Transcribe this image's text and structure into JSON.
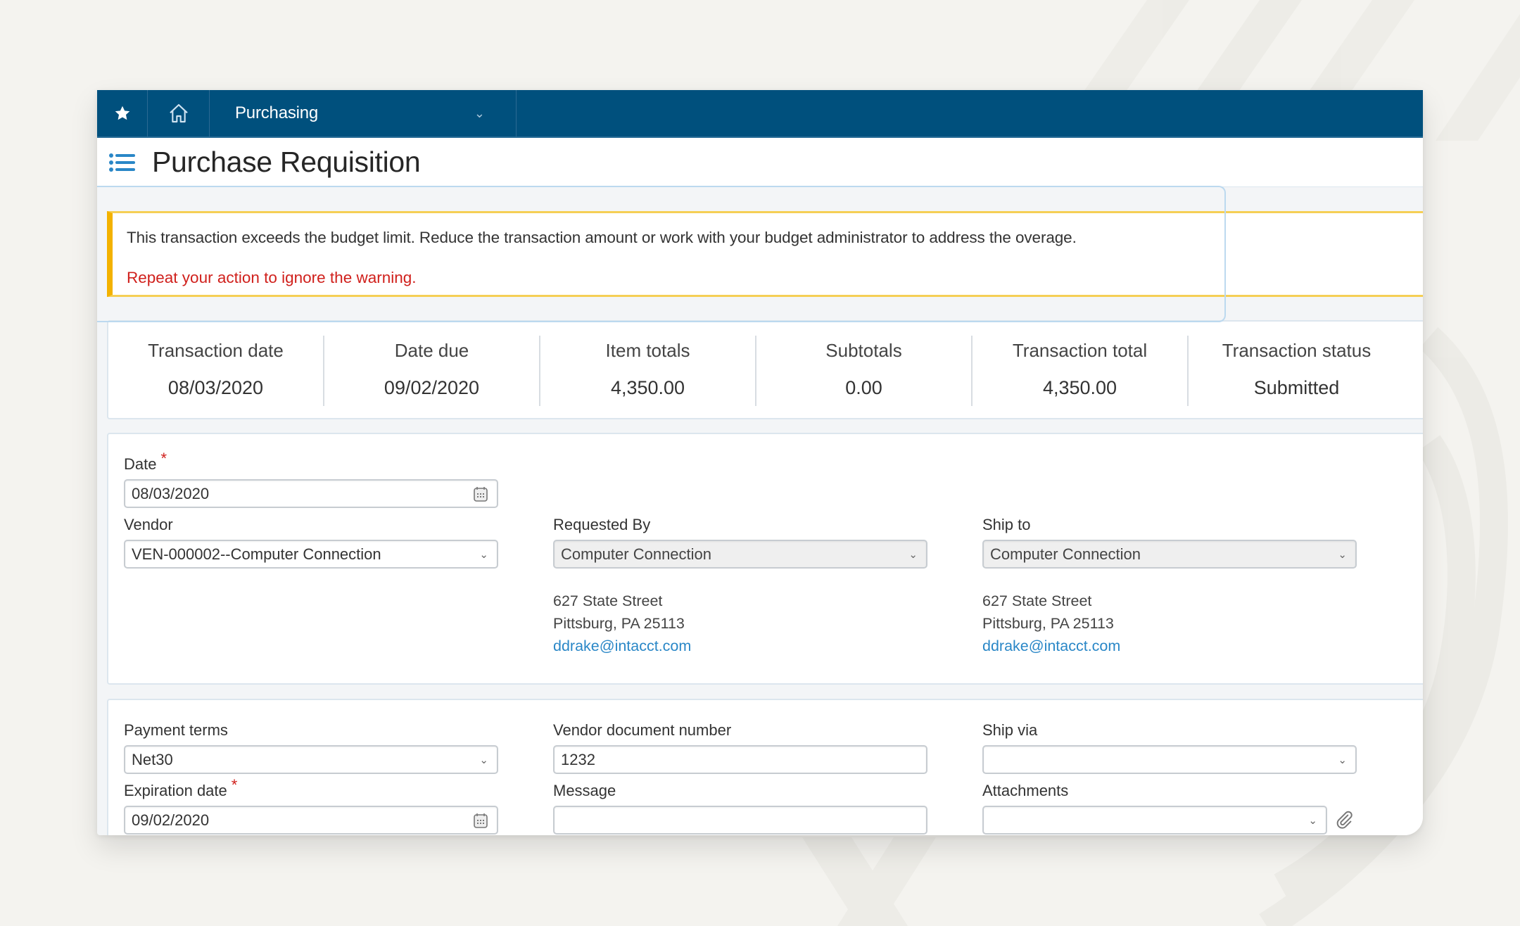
{
  "nav": {
    "favorites_icon": "star-icon",
    "home_icon": "home-icon",
    "module_label": "Purchasing",
    "module_chevron": "chevron-down-icon"
  },
  "page": {
    "menu_icon": "list-menu-icon",
    "title": "Purchase Requisition"
  },
  "warning": {
    "message": "This transaction exceeds the budget limit. Reduce the transaction amount or work with your budget administrator to address the overage.",
    "hint": "Repeat your action to ignore the warning.",
    "accent_color": "#f3b200",
    "hint_color": "#d0201c"
  },
  "summary": [
    {
      "label": "Transaction date",
      "value": "08/03/2020"
    },
    {
      "label": "Date due",
      "value": "09/02/2020"
    },
    {
      "label": "Item totals",
      "value": "4,350.00"
    },
    {
      "label": "Subtotals",
      "value": "0.00"
    },
    {
      "label": "Transaction total",
      "value": "4,350.00"
    },
    {
      "label": "Transaction status",
      "value": "Submitted"
    }
  ],
  "header_fields": {
    "date": {
      "label": "Date",
      "required": "*",
      "value": "08/03/2020",
      "icon": "calendar-icon"
    },
    "vendor": {
      "label": "Vendor",
      "value": "VEN-000002--Computer Connection"
    },
    "requested_by": {
      "label": "Requested By",
      "value": "Computer Connection",
      "address_line1": "627 State Street",
      "address_line2": "Pittsburg, PA 25113",
      "email": "ddrake@intacct.com"
    },
    "ship_to": {
      "label": "Ship to",
      "value": "Computer Connection",
      "address_line1": "627 State Street",
      "address_line2": "Pittsburg, PA 25113",
      "email": "ddrake@intacct.com"
    }
  },
  "detail_fields": {
    "payment_terms": {
      "label": "Payment terms",
      "value": "Net30"
    },
    "vendor_doc_number": {
      "label": "Vendor document number",
      "value": "1232"
    },
    "ship_via": {
      "label": "Ship via",
      "value": ""
    },
    "expiration_date": {
      "label": "Expiration date",
      "required": "*",
      "value": "09/02/2020",
      "icon": "calendar-icon"
    },
    "message": {
      "label": "Message",
      "value": ""
    },
    "attachments": {
      "label": "Attachments",
      "value": "",
      "icon": "paperclip-icon"
    }
  },
  "colors": {
    "nav_bg": "#00507d",
    "link": "#2a87c7",
    "background": "#f4f3ef"
  }
}
